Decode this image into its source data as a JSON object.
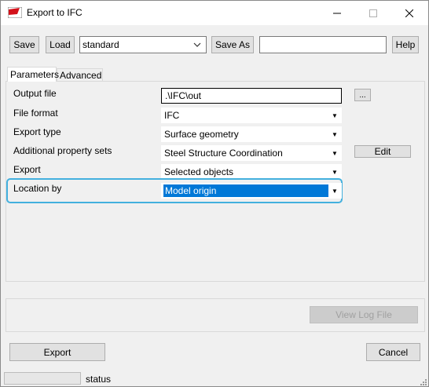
{
  "window": {
    "title": "Export to IFC"
  },
  "toolbar": {
    "save_label": "Save",
    "load_label": "Load",
    "preset_value": "standard",
    "save_as_label": "Save As",
    "save_as_value": "",
    "help_label": "Help"
  },
  "tabs": [
    {
      "label": "Parameters",
      "active": true
    },
    {
      "label": "Advanced",
      "active": false
    }
  ],
  "parameters": {
    "output_file_label": "Output file",
    "output_file_value": ".\\IFC\\out",
    "browse_label": "...",
    "file_format_label": "File format",
    "file_format_value": "IFC",
    "export_type_label": "Export type",
    "export_type_value": "Surface geometry",
    "property_sets_label": "Additional property sets",
    "property_sets_value": "Steel Structure Coordination",
    "edit_label": "Edit",
    "export_label": "Export",
    "export_value": "Selected objects",
    "location_label": "Location by",
    "location_value": "Model origin"
  },
  "log": {
    "view_log_label": "View Log File"
  },
  "footer": {
    "export_label": "Export",
    "cancel_label": "Cancel"
  },
  "statusbar": {
    "text": "status"
  },
  "colors": {
    "selection": "#0078d7",
    "highlight": "#43b0de"
  }
}
